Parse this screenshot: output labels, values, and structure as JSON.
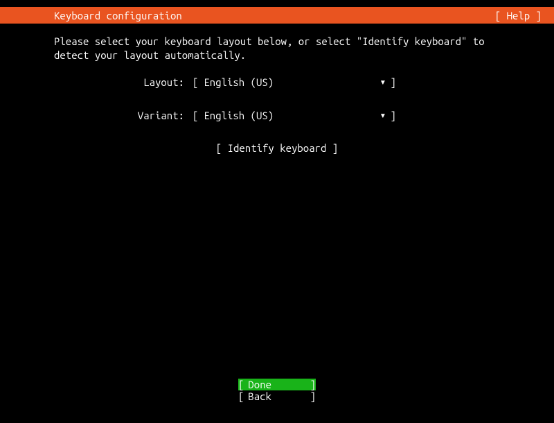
{
  "header": {
    "title": "Keyboard configuration",
    "help_label": "[ Help ]"
  },
  "instruction": "Please select your keyboard layout below, or select \"Identify keyboard\" to detect your layout automatically.",
  "form": {
    "layout": {
      "label": "Layout:",
      "value": "English (US)"
    },
    "variant": {
      "label": "Variant:",
      "value": "English (US)"
    },
    "identify_label": "[ Identify keyboard ]"
  },
  "footer": {
    "done_label": "Done",
    "back_label": "Back"
  }
}
